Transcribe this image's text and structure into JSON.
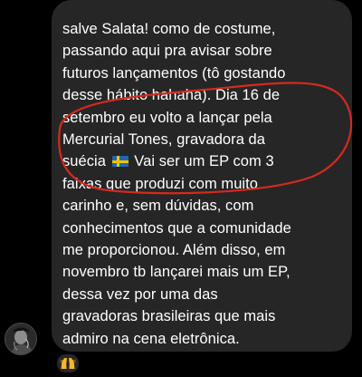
{
  "message": {
    "lines": [
      "salve Salata! como de costume,",
      "passando aqui pra avisar sobre",
      "futuros lançamentos (tô gostando",
      "desse hábito hahaha). Dia 16 de",
      "setembro eu volto a lançar pela",
      "Mercurial Tones, gravadora da",
      "Vai ser um EP com 3",
      "faixas que produzi com muito",
      "carinho e, sem dúvidas, com",
      "conhecimentos que a comunidade",
      "me proporcionou. Além disso, em",
      "novembro tb lançarei mais um EP,",
      "dessa vez por uma das",
      "gravadoras brasileiras que mais",
      "admiro na cena eletrônica."
    ],
    "line7_prefix": "suécia",
    "flag_icon": "sweden-flag-icon"
  },
  "reaction": {
    "icon": "raising-hands-icon"
  },
  "avatar": {
    "icon": "sender-avatar"
  },
  "colors": {
    "background": "#000000",
    "bubble": "#262626",
    "text": "#ffffff",
    "highlight_stroke": "#d42a1e"
  }
}
